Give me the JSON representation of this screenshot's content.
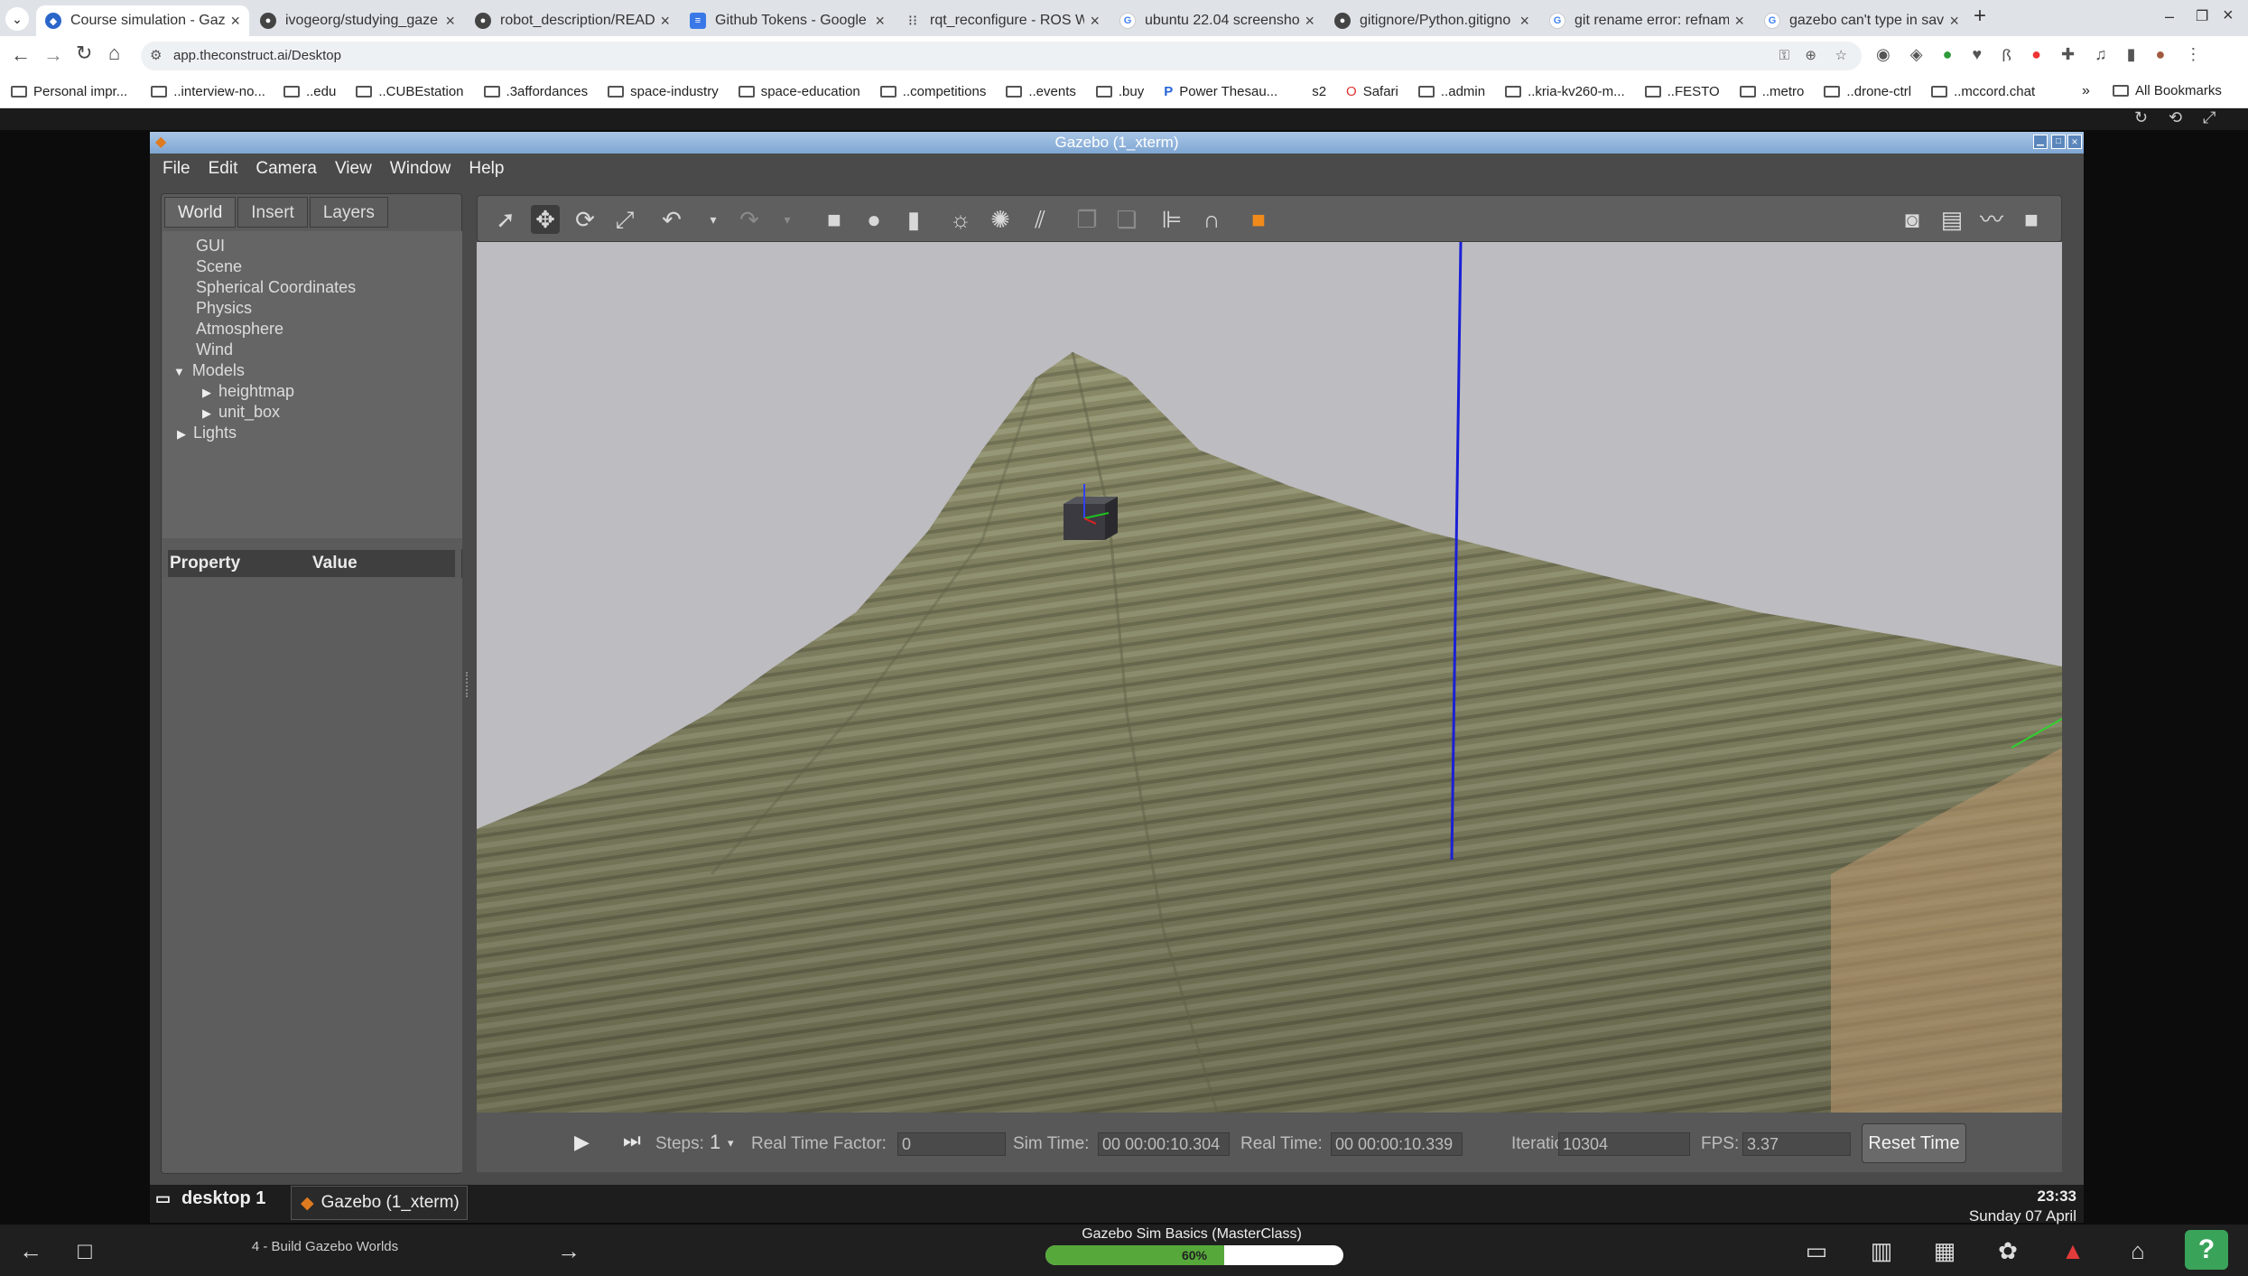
{
  "browser": {
    "tabs": [
      {
        "label": "Course simulation - Gaze"
      },
      {
        "label": "ivogeorg/studying_gaze"
      },
      {
        "label": "robot_description/READ"
      },
      {
        "label": "Github Tokens - Google"
      },
      {
        "label": "rqt_reconfigure - ROS W"
      },
      {
        "label": "ubuntu 22.04 screensho"
      },
      {
        "label": "gitignore/Python.gitigno"
      },
      {
        "label": "git rename error: refnam"
      },
      {
        "label": "gazebo can't type in sav"
      }
    ],
    "new_tab": "+",
    "url": "app.theconstruct.ai/Desktop",
    "bookmarks": [
      "Personal impr...",
      "..interview-no...",
      "..edu",
      "..CUBEstation",
      ".3affordances",
      "space-industry",
      "space-education",
      "..competitions",
      "..events",
      ".buy",
      "Power Thesau...",
      "s2",
      "Safari",
      "..admin",
      "..kria-kv260-m...",
      "..FESTO",
      "..metro",
      "..drone-ctrl",
      "..mccord.chat"
    ],
    "all_bookmarks": "All Bookmarks"
  },
  "gazebo": {
    "window_title": "Gazebo (1_xterm)",
    "menu": [
      "File",
      "Edit",
      "Camera",
      "View",
      "Window",
      "Help"
    ],
    "panel_tabs": [
      "World",
      "Insert",
      "Layers"
    ],
    "tree": {
      "gui": "GUI",
      "scene": "Scene",
      "spherical": "Spherical Coordinates",
      "physics": "Physics",
      "atmosphere": "Atmosphere",
      "wind": "Wind",
      "models": "Models",
      "heightmap": "heightmap",
      "unit_box": "unit_box",
      "lights": "Lights"
    },
    "property_header": "Property",
    "value_header": "Value",
    "bottom": {
      "steps_label": "Steps:",
      "steps_value": "1",
      "rtf_label": "Real Time Factor:",
      "rtf_value": "0",
      "sim_label": "Sim Time:",
      "sim_value": "00 00:00:10.304",
      "real_label": "Real Time:",
      "real_value": "00 00:00:10.339",
      "iter_label": "Iterations:",
      "iter_value": "10304",
      "fps_label": "FPS:",
      "fps_value": "3.37",
      "reset": "Reset Time"
    }
  },
  "taskbar": {
    "desktop": "desktop 1",
    "app": "Gazebo (1_xterm)",
    "time": "23:33",
    "date": "Sunday 07 April"
  },
  "navbar": {
    "unit": "4 - Build Gazebo Worlds",
    "course": "Gazebo Sim Basics (MasterClass)",
    "progress_text": "60%",
    "progress": 0.6
  }
}
